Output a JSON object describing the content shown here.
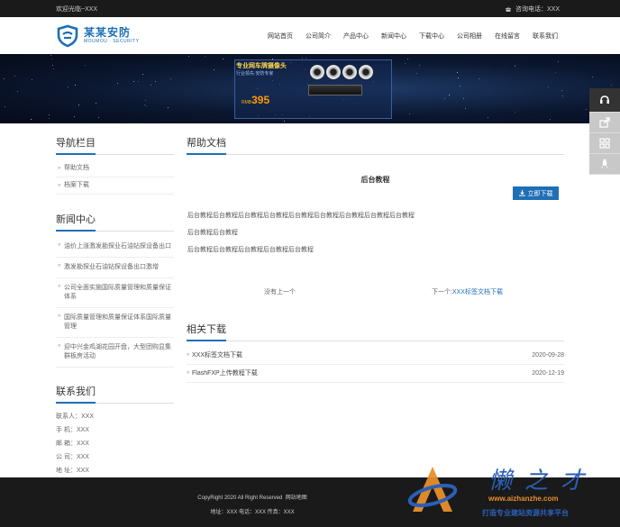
{
  "topbar": {
    "welcome": "欢迎光临~XXX",
    "phone_label": "咨询电话：XXX"
  },
  "logo": {
    "name": "某某安防",
    "english": "MOUMOU · SECURITY"
  },
  "nav": [
    {
      "label": "网站首页"
    },
    {
      "label": "公司简介"
    },
    {
      "label": "产品中心"
    },
    {
      "label": "新闻中心"
    },
    {
      "label": "下载中心"
    },
    {
      "label": "公司相册"
    },
    {
      "label": "在线留言"
    },
    {
      "label": "联系我们"
    }
  ],
  "banner": {
    "title": "专业网车牌摄像头",
    "subtitle": "行业领先 安防专家",
    "price_prefix": "RMB",
    "price": "395"
  },
  "sidebar": {
    "nav_title": "导航栏目",
    "nav_items": [
      {
        "label": "帮助文档"
      },
      {
        "label": "档案下载"
      }
    ],
    "news_title": "新闻中心",
    "news_items": [
      {
        "label": "油价上涨激发勘探业石油钻探设备出口"
      },
      {
        "label": "激发勘探业石油钻探设备出口激增"
      },
      {
        "label": "公司全面实施国际质量管理和质量保证体系"
      },
      {
        "label": "国际质量管理和质量保证体系国际质量管理"
      },
      {
        "label": "迎中兴金鸡湖花园开盘，大型团购显集群板房活动"
      }
    ],
    "contact_title": "联系我们",
    "contact_items": [
      {
        "label": "联系人：XXX"
      },
      {
        "label": "手  机：XXX"
      },
      {
        "label": "邮  箱：XXX"
      },
      {
        "label": "公  司：XXX"
      },
      {
        "label": "地  址：XXX"
      }
    ]
  },
  "main": {
    "section_title": "帮助文档",
    "article_title": "后台教程",
    "download_label": "立即下载",
    "paragraphs": [
      "后台教程后台教程后台教程后台教程后台教程后台教程后台教程后台教程后台教程",
      "后台教程后台教程",
      "后台教程后台教程后台教程后台教程后台教程"
    ],
    "prev": "没有上一个",
    "next_prefix": "下一个:",
    "next_link": "XXX标签文档下载",
    "related_title": "相关下载",
    "related": [
      {
        "title": "XXX标签文档下载",
        "date": "2020-09-28"
      },
      {
        "title": "FlashFXP上传教程下载",
        "date": "2020-12-19"
      }
    ]
  },
  "footer": {
    "copyright": "CopyRight 2020 All Right Reserved",
    "sitemap": "网站地图",
    "address": "地址：XXX  电话：XXX  传真：XXX"
  },
  "watermark": {
    "brand": "懒之才",
    "url": "www.aizhanzhe.com",
    "slogan": "打造专业建站资源共享平台"
  },
  "colors": {
    "accent": "#1e6fb5",
    "topbar": "#1a1a1a",
    "footer": "#1a1a1a"
  },
  "icons": {
    "phone": "phone-icon",
    "download": "download-icon",
    "logo": "shield-logo-icon"
  }
}
